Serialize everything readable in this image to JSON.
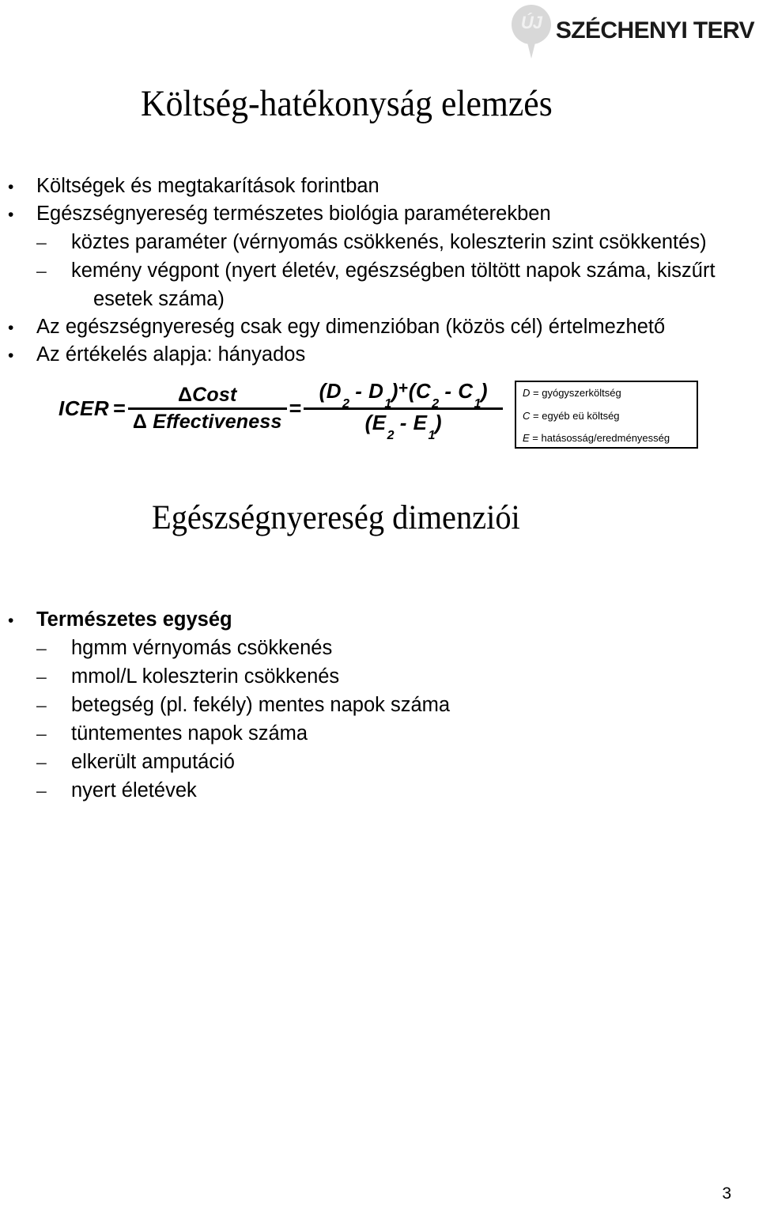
{
  "header": {
    "logo": {
      "pin_label": "ÚJ",
      "wordmark": "SZÉCHENYI TERV"
    }
  },
  "slide": {
    "title_1": "Költség-hatékonyság elemzés",
    "title_2": "Egészségnyereség dimenziói",
    "page_number": "3"
  },
  "section_1": {
    "items": [
      {
        "level": 1,
        "marker": "•",
        "text": "Költségek és megtakarítások forintban",
        "bold": false
      },
      {
        "level": 1,
        "marker": "•",
        "text": "Egészségnyereség természetes biológia paraméterekben",
        "bold": false
      },
      {
        "level": 2,
        "marker": "–",
        "text": "köztes paraméter (vérnyomás csökkenés, koleszterin szint csökkentés)",
        "bold": false
      },
      {
        "level": 2,
        "marker": "–",
        "text": "kemény végpont (nyert életév, egészségben töltött napok száma, kiszűrt",
        "bold": false
      },
      {
        "level": 0,
        "marker": "",
        "text": "esetek száma)",
        "bold": false
      },
      {
        "level": 1,
        "marker": "•",
        "text": "Az egészségnyereség csak egy dimenzióban (közös cél) értelmezhető",
        "bold": false
      },
      {
        "level": 1,
        "marker": "•",
        "text": "Az értékelés alapja: hányados",
        "bold": false
      }
    ]
  },
  "formula": {
    "icer_label": "ICER",
    "equals": "=",
    "left": {
      "numerator_delta": "Δ",
      "numerator_text": "Cost",
      "denominator_delta": "Δ",
      "denominator_text": "Effectiveness"
    },
    "right": {
      "numerator": "( D2 - D1 ) + ( C2 - C1 )",
      "denominator": "( E2 - E1 )",
      "num_open1": "(",
      "num_d": "D",
      "num_d_sub1": "2",
      "num_minus1": "-",
      "num_d2": "D",
      "num_d_sub2": "1",
      "num_close1": ")",
      "num_plus": "+",
      "num_open2": "(",
      "num_c": "C",
      "num_c_sub1": "2",
      "num_minus2": "-",
      "num_c2": "C",
      "num_c_sub2": "1",
      "num_close2": ")",
      "den_open": "(",
      "den_e": "E",
      "den_e_sub1": "2",
      "den_minus": "-",
      "den_e2": "E",
      "den_e_sub2": "1",
      "den_close": ")"
    }
  },
  "legend": {
    "rows": [
      {
        "symbol": "D",
        "equals": "=",
        "definition": "gyógyszerköltség"
      },
      {
        "symbol": "C",
        "equals": "=",
        "definition": "egyéb eü költség"
      },
      {
        "symbol": "E",
        "equals": "=",
        "definition": "hatásosság/eredményesség"
      }
    ]
  },
  "section_2": {
    "items": [
      {
        "level": 1,
        "marker": "•",
        "text": "Természetes egység",
        "bold": true
      },
      {
        "level": 2,
        "marker": "–",
        "text": "hgmm vérnyomás csökkenés",
        "bold": false
      },
      {
        "level": 2,
        "marker": "–",
        "text": "mmol/L koleszterin csökkenés",
        "bold": false
      },
      {
        "level": 2,
        "marker": "–",
        "text": "betegség (pl. fekély) mentes napok száma",
        "bold": false
      },
      {
        "level": 2,
        "marker": "–",
        "text": "tüntementes napok száma",
        "bold": false
      },
      {
        "level": 2,
        "marker": "–",
        "text": "elkerült amputáció",
        "bold": false
      },
      {
        "level": 2,
        "marker": "–",
        "text": "nyert életévek",
        "bold": false
      }
    ]
  }
}
